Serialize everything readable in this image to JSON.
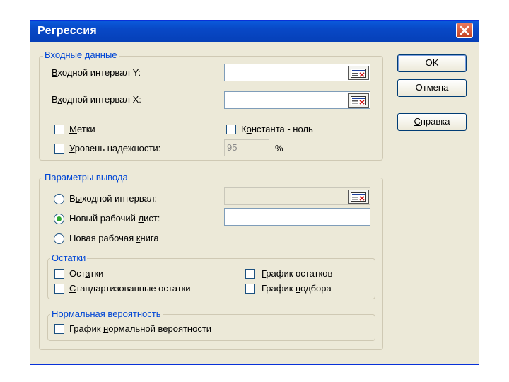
{
  "dialog": {
    "title": "Регрессия"
  },
  "input_group": {
    "legend": "Входные данные",
    "y_range": {
      "label_u": "В",
      "label_rest": "ходной интервал Y:",
      "value": ""
    },
    "x_range": {
      "label_pre": "В",
      "label_u": "х",
      "label_rest": "одной интервал X:",
      "value": ""
    },
    "labels": {
      "label_u": "М",
      "label_rest": "етки",
      "checked": false
    },
    "constant_zero": {
      "label_pre": "К",
      "label_u": "о",
      "label_rest": "нстанта - ноль",
      "checked": false
    },
    "confidence": {
      "label_u": "У",
      "label_rest": "ровень надежности:",
      "checked": false,
      "value": "95",
      "unit": "%"
    }
  },
  "output_group": {
    "legend": "Параметры вывода",
    "output_range": {
      "label_pre": "В",
      "label_u": "ы",
      "label_rest": "ходной интервал:",
      "selected": false,
      "value": ""
    },
    "new_sheet": {
      "label_pre": "Новый рабочий ",
      "label_u": "л",
      "label_rest": "ист:",
      "selected": true,
      "value": ""
    },
    "new_book": {
      "label_pre": "Новая рабочая ",
      "label_u": "к",
      "label_rest": "нига",
      "selected": false
    }
  },
  "residuals_group": {
    "legend": "Остатки",
    "residuals": {
      "label_pre": "Ост",
      "label_u": "а",
      "label_rest": "тки",
      "checked": false
    },
    "std_residuals": {
      "label_u": "С",
      "label_rest": "тандартизованные остатки",
      "checked": false
    },
    "residual_plot": {
      "label_u": "Г",
      "label_rest": "рафик остатков",
      "checked": false
    },
    "fit_plot": {
      "label_pre": "График ",
      "label_u": "п",
      "label_rest": "одбора",
      "checked": false
    }
  },
  "normal_group": {
    "legend": "Нормальная вероятность",
    "normal_plot": {
      "label_pre": "График ",
      "label_u": "н",
      "label_rest": "ормальной вероятности",
      "checked": false
    }
  },
  "buttons": {
    "ok": "OK",
    "cancel": "Отмена",
    "help_u": "С",
    "help_rest": "правка"
  },
  "icons": {
    "close": "close-icon",
    "range_ref": "collapse-dialog-icon"
  }
}
